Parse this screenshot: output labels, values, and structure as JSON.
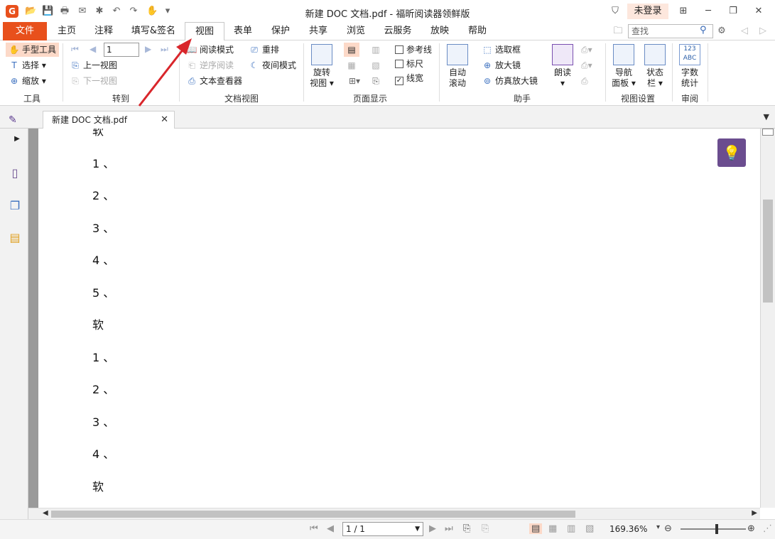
{
  "window": {
    "title": "新建 DOC 文档.pdf - 福昕阅读器领鲜版",
    "login": "未登录"
  },
  "ribbon_tabs": [
    {
      "label": "文件"
    },
    {
      "label": "主页"
    },
    {
      "label": "注释"
    },
    {
      "label": "填写&签名"
    },
    {
      "label": "视图"
    },
    {
      "label": "表单"
    },
    {
      "label": "保护"
    },
    {
      "label": "共享"
    },
    {
      "label": "浏览"
    },
    {
      "label": "云服务"
    },
    {
      "label": "放映"
    },
    {
      "label": "帮助"
    }
  ],
  "active_tab": "视图",
  "search": {
    "placeholder": "查找"
  },
  "ribbon": {
    "tools": {
      "hand": "手型工具",
      "select": "选择",
      "zoom": "缩放",
      "label": "工具"
    },
    "goto": {
      "page": "1",
      "prev_view": "上一视图",
      "next_view": "下一视图",
      "label": "转到"
    },
    "docview": {
      "read_mode": "阅读模式",
      "reverse_read": "逆序阅读",
      "text_viewer": "文本查看器",
      "reflow": "重排",
      "night_mode": "夜间模式",
      "label": "文档视图"
    },
    "rotate": {
      "line1": "旋转",
      "line2": "视图"
    },
    "pagedisplay": {
      "guides": "参考线",
      "ruler": "标尺",
      "linewidth": "线宽",
      "label": "页面显示"
    },
    "autoscroll": {
      "line1": "自动",
      "line2": "滚动"
    },
    "assistant": {
      "marquee": "选取框",
      "magnifier": "放大镜",
      "loupe": "仿真放大镜",
      "label": "助手"
    },
    "read_aloud": "朗读",
    "viewsettings": {
      "nav_line1": "导航",
      "nav_line2": "面板",
      "status_line1": "状态",
      "status_line2": "栏",
      "label": "视图设置"
    },
    "review": {
      "icon_text": "123\nABC",
      "line1": "字数",
      "line2": "统计",
      "label": "审阅"
    }
  },
  "doc_tab": {
    "name": "新建 DOC 文档.pdf"
  },
  "document_lines": [
    "软",
    "1 、",
    "2 、",
    "3 、",
    "4 、",
    "5 、",
    "软",
    "1 、",
    "2 、",
    "3 、",
    "4 、",
    "软"
  ],
  "statusbar": {
    "page": "1 / 1",
    "zoom": "169.36%"
  },
  "colors": {
    "accent": "#e8501c",
    "arrow": "#d9262b",
    "tip_button": "#6b4d8f"
  }
}
